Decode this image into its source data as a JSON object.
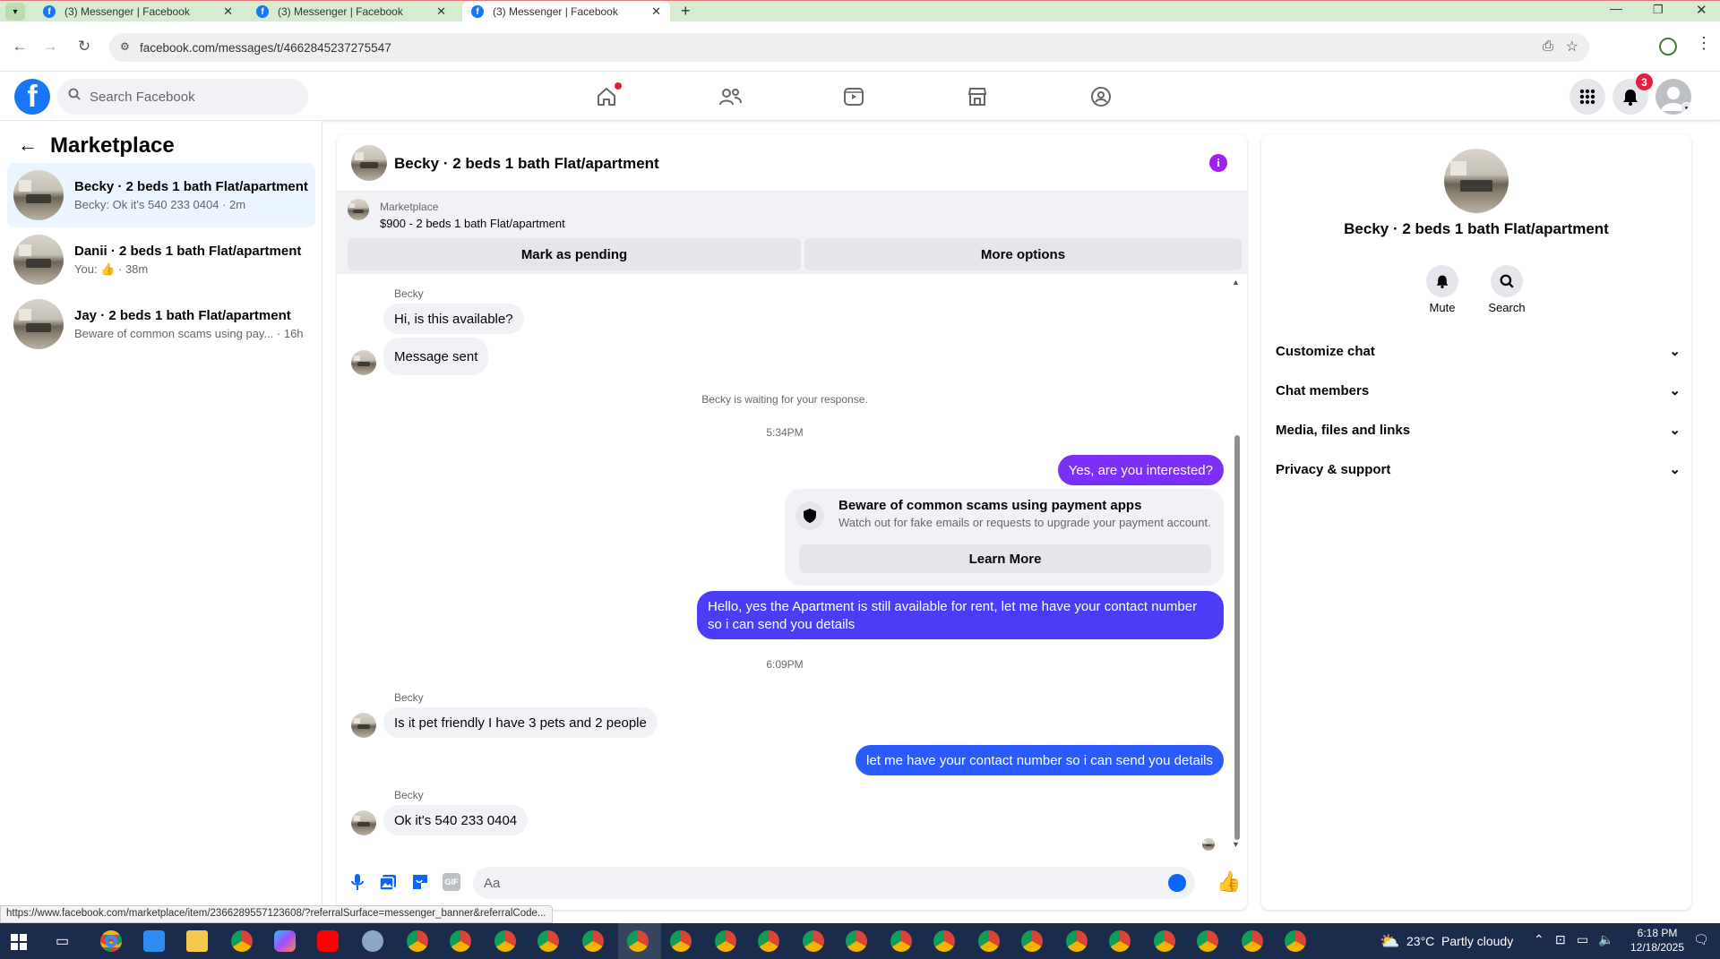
{
  "browser": {
    "tabs": [
      {
        "title": "(3) Messenger | Facebook"
      },
      {
        "title": "(3) Messenger | Facebook"
      },
      {
        "title": "(3) Messenger | Facebook"
      }
    ],
    "url": "facebook.com/messages/t/4662845237275547",
    "status_url": "https://www.facebook.com/marketplace/item/2366289557123608/?referralSurface=messenger_banner&referralCode..."
  },
  "header": {
    "search_placeholder": "Search Facebook",
    "notification_count": "3",
    "nav_icons": [
      "home-icon",
      "friends-icon",
      "video-icon",
      "marketplace-icon",
      "groups-icon"
    ]
  },
  "sidebar": {
    "title": "Marketplace",
    "conversations": [
      {
        "name": "Becky · 2 beds 1 bath Flat/apartment",
        "preview": "Becky: Ok it's 540 233 0404 · 2m"
      },
      {
        "name": "Danii · 2 beds 1 bath Flat/apartment",
        "preview_prefix": "You:",
        "preview_suffix": "· 38m"
      },
      {
        "name": "Jay · 2 beds 1 bath Flat/apartment",
        "preview": "Beware of common scams using pay... · 16h"
      }
    ]
  },
  "chat": {
    "title": "Becky · 2 beds 1 bath Flat/apartment",
    "marketplace_label": "Marketplace",
    "listing": "$900 - 2 beds 1 bath Flat/apartment",
    "mark_pending": "Mark as pending",
    "more_options": "More options",
    "messages": {
      "sender1": "Becky",
      "m1": "Hi, is this available?",
      "m2": "Message sent",
      "waiting": "Becky is waiting for your response.",
      "time1": "5:34PM",
      "m3": "Yes, are you interested?",
      "scam_title": "Beware of common scams using payment apps",
      "scam_sub": "Watch out for fake emails or requests to upgrade your payment account.",
      "learn_more": "Learn More",
      "m4_line1": "Hello, yes the Apartment is still available for rent, let me have your contact number",
      "m4_line2": "so i can send you details",
      "time2": "6:09PM",
      "sender2": "Becky",
      "m5": "Is it pet friendly I have 3 pets and 2 people",
      "m6": "let me have your contact number so i can send you details",
      "sender3": "Becky",
      "m7": "Ok it's 540 233 0404"
    },
    "composer_placeholder": "Aa",
    "colors": {
      "out_purple": "#7b2ff7",
      "out_blue": "#2a5bff",
      "out_mid": "#4b3cf7",
      "accent": "#0866ff"
    }
  },
  "details": {
    "title": "Becky · 2 beds 1 bath Flat/apartment",
    "mute": "Mute",
    "search": "Search",
    "sections": [
      "Customize chat",
      "Chat members",
      "Media, files and links",
      "Privacy & support"
    ]
  },
  "taskbar": {
    "weather": "23°C  Partly cloudy",
    "time": "6:18 PM",
    "date": "12/18/2025"
  }
}
